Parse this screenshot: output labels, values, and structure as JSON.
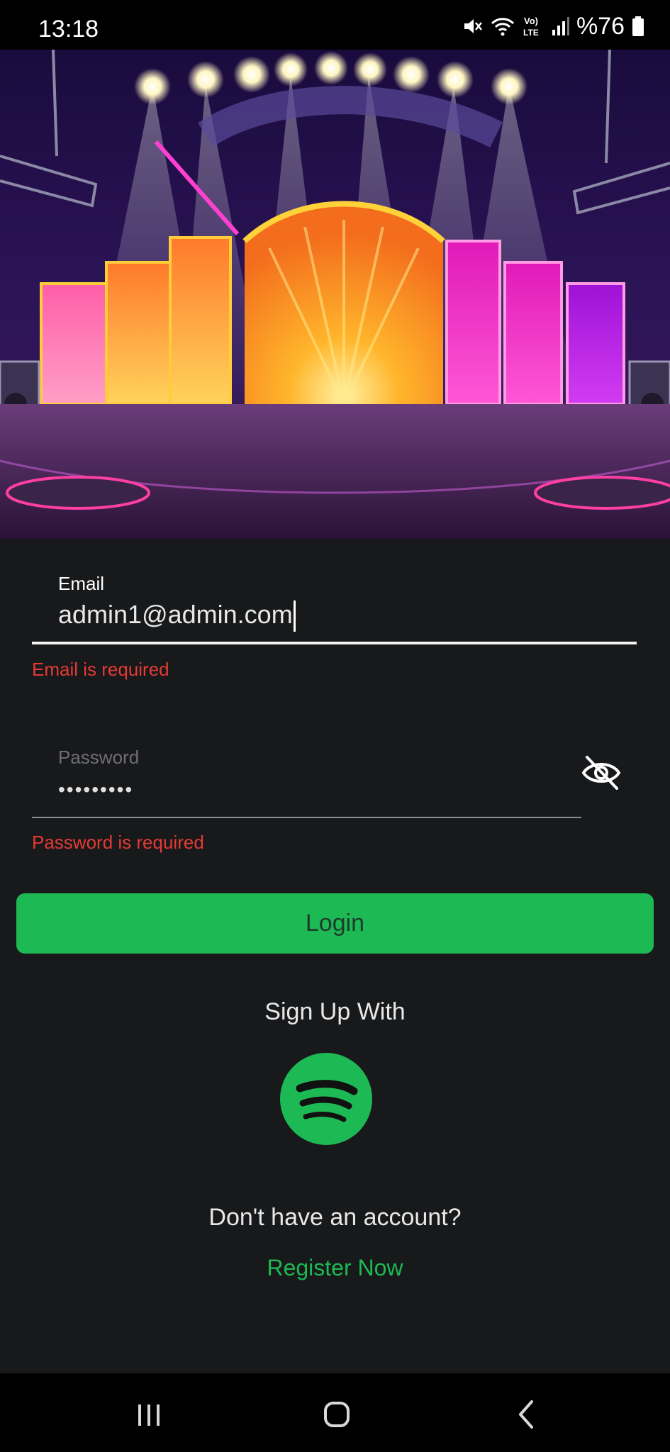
{
  "status_bar": {
    "time": "13:18",
    "battery": "%76",
    "icons": [
      "mute-icon",
      "wifi-icon",
      "volte-icon",
      "signal-icon",
      "battery-icon"
    ]
  },
  "hero": {
    "image": "concert-stage-illustration"
  },
  "login_form": {
    "email": {
      "label": "Email",
      "value": "admin1@admin.com",
      "error": "Email is required"
    },
    "password": {
      "label": "Password",
      "value": "•••••••••",
      "error": "Password is required",
      "toggle_icon": "eye-off-icon"
    },
    "login_button": "Login"
  },
  "social": {
    "label": "Sign Up With",
    "provider_icon": "spotify-icon"
  },
  "register": {
    "prompt": "Don't have an account?",
    "link": "Register Now"
  },
  "nav_bar": {
    "buttons": [
      "recents-icon",
      "home-icon",
      "back-icon"
    ]
  },
  "colors": {
    "background": "#18191b",
    "accent_green": "#1db954",
    "error_red": "#e53a35"
  }
}
